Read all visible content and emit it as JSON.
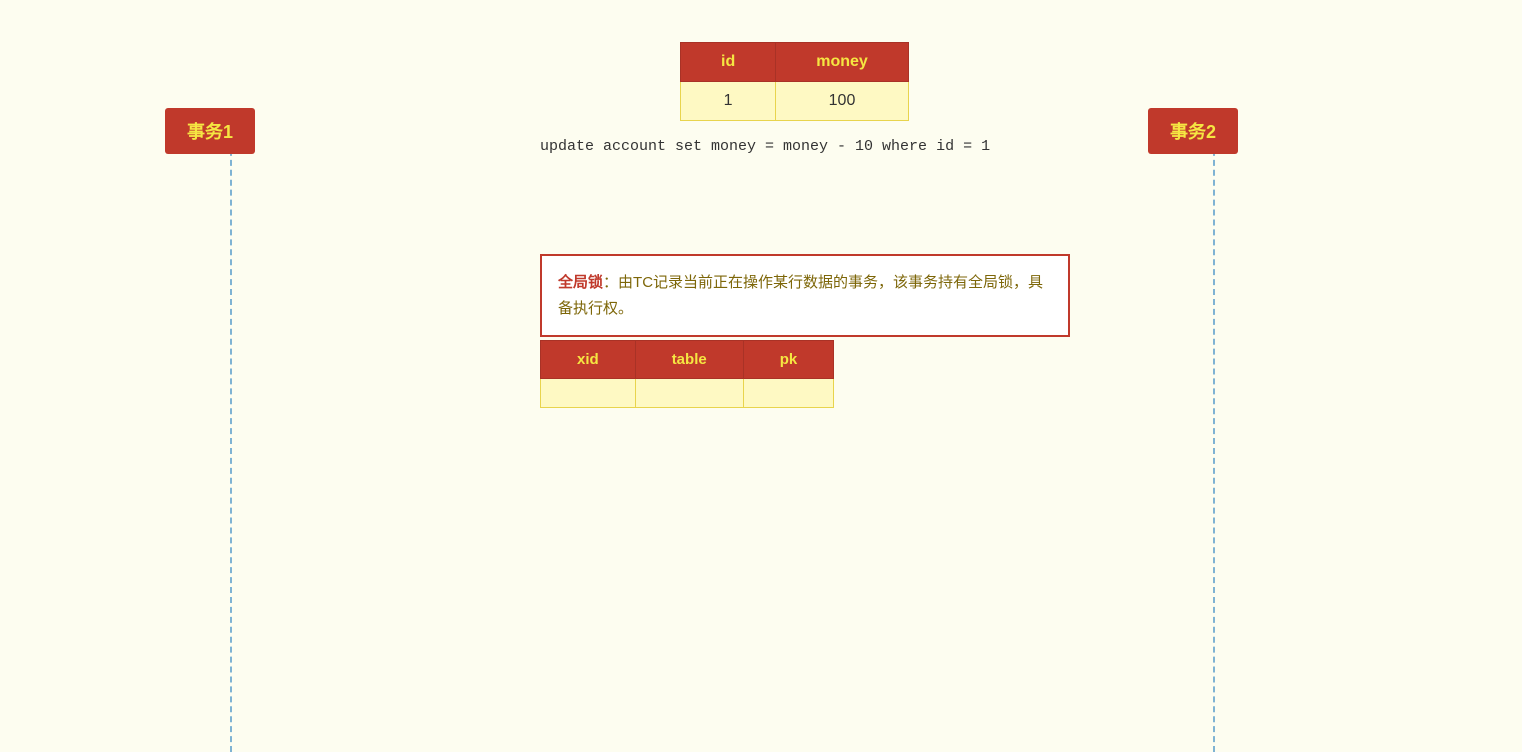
{
  "background_color": "#fdfdf0",
  "transaction1": {
    "label": "事务1"
  },
  "transaction2": {
    "label": "事务2"
  },
  "account_table": {
    "headers": [
      "id",
      "money"
    ],
    "rows": [
      {
        "id": "1",
        "money": "100"
      }
    ]
  },
  "sql_statement": "update account set money = money - 10 where id = 1",
  "info_box": {
    "highlight": "全局锁",
    "colon": "：",
    "text": "由TC记录当前正在操作某行数据的事务，该事务持有全局锁，具备执行权。"
  },
  "lock_table": {
    "headers": [
      "xid",
      "table",
      "pk"
    ],
    "rows": [
      {
        "xid": "",
        "table": "",
        "pk": ""
      }
    ]
  }
}
